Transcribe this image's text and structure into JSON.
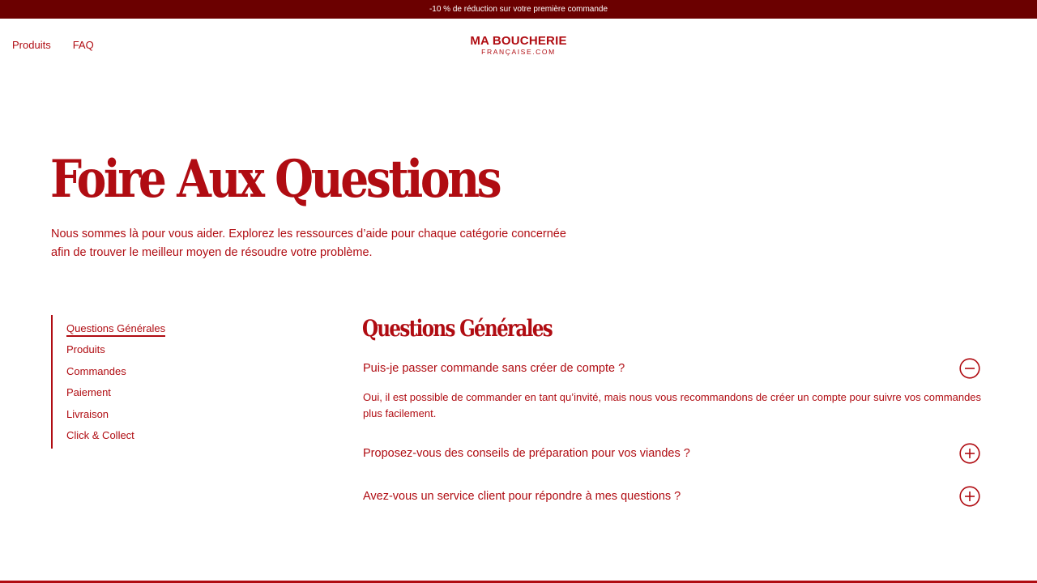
{
  "promo": {
    "text": "-10 % de réduction sur votre première commande"
  },
  "nav": {
    "products": "Produits",
    "faq": "FAQ"
  },
  "logo": {
    "main": "MA BOUCHERIE",
    "sub": "FRANÇAISE.COM"
  },
  "hero": {
    "title": "Foire Aux Questions",
    "description": "Nous sommes là pour vous aider. Explorez les ressources d’aide pour chaque catégorie concernée afin de trouver le meilleur moyen de résoudre votre problème."
  },
  "sidebar": {
    "items": [
      {
        "label": "Questions Générales",
        "active": true
      },
      {
        "label": "Produits"
      },
      {
        "label": "Commandes"
      },
      {
        "label": "Paiement"
      },
      {
        "label": "Livraison"
      },
      {
        "label": "Click & Collect"
      }
    ]
  },
  "section": {
    "title": "Questions Générales",
    "faqs": [
      {
        "question": "Puis-je passer commande sans créer de compte ?",
        "answer": "Oui, il est possible de commander en tant qu’invité, mais nous vous recommandons de créer un compte pour suivre vos commandes plus facilement.",
        "expanded": true,
        "icon": "minus-circle-icon"
      },
      {
        "question": "Proposez-vous des conseils de préparation pour vos viandes ?",
        "expanded": false,
        "icon": "plus-circle-icon"
      },
      {
        "question": "Avez-vous un service client pour répondre à mes questions ?",
        "expanded": false,
        "icon": "plus-circle-icon"
      }
    ]
  },
  "colors": {
    "brand": "#b00c12",
    "promo_bg": "#6b0000",
    "background": "#ffffff"
  }
}
